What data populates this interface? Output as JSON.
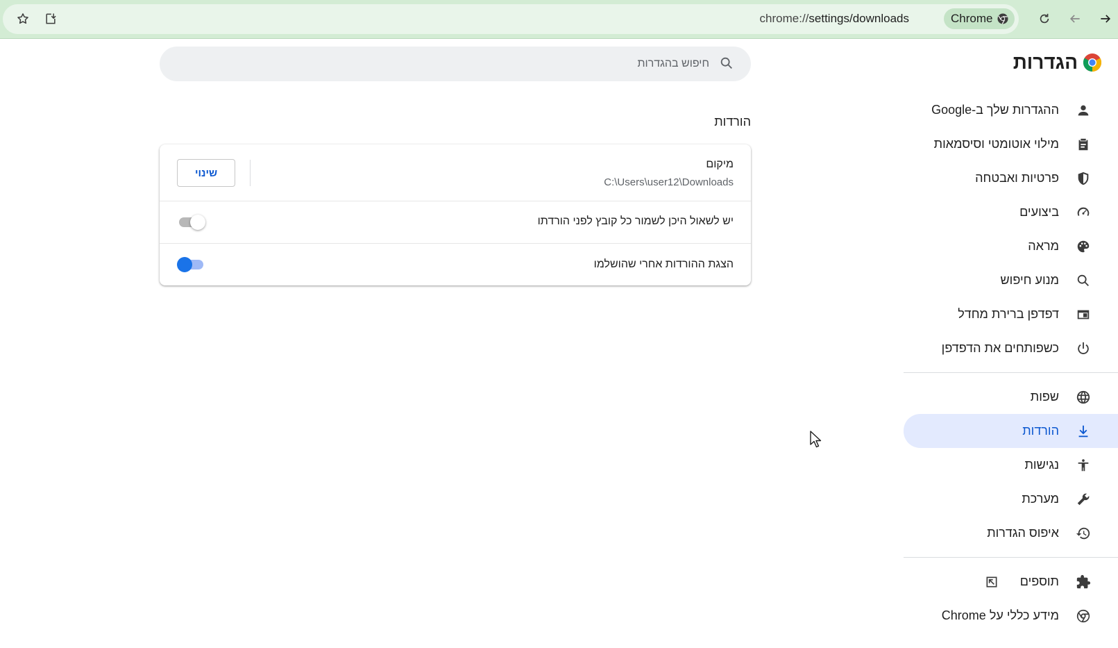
{
  "browser": {
    "url_prefix": "chrome://",
    "url_path": "settings/downloads",
    "chip_label": "Chrome",
    "toolbar_bg": "#d3ecd4"
  },
  "sidebar": {
    "title": "הגדרות",
    "items": [
      {
        "label": "ההגדרות שלך ב-Google",
        "icon": "person-icon"
      },
      {
        "label": "מילוי אוטומטי וסיסמאות",
        "icon": "clipboard-icon"
      },
      {
        "label": "פרטיות ואבטחה",
        "icon": "shield-icon"
      },
      {
        "label": "ביצועים",
        "icon": "speedometer-icon"
      },
      {
        "label": "מראה",
        "icon": "palette-icon"
      },
      {
        "label": "מנוע חיפוש",
        "icon": "search-icon"
      },
      {
        "label": "דפדפן ברירת מחדל",
        "icon": "browser-window-icon"
      },
      {
        "label": "כשפותחים את הדפדפן",
        "icon": "power-icon"
      }
    ],
    "items2": [
      {
        "label": "שפות",
        "icon": "globe-icon"
      },
      {
        "label": "הורדות",
        "icon": "download-icon",
        "active": true
      },
      {
        "label": "נגישות",
        "icon": "accessibility-icon"
      },
      {
        "label": "מערכת",
        "icon": "wrench-icon"
      },
      {
        "label": "איפוס הגדרות",
        "icon": "history-icon"
      }
    ],
    "items3": [
      {
        "label": "תוספים",
        "icon": "puzzle-icon"
      },
      {
        "label": "מידע כללי על Chrome",
        "icon": "chrome-icon"
      }
    ]
  },
  "search": {
    "placeholder": "חיפוש בהגדרות"
  },
  "downloads": {
    "section_title": "הורדות",
    "location_label": "מיקום",
    "location_path": "C:\\Users\\user12\\Downloads",
    "change_button": "שינוי",
    "ask_label": "יש לשאול היכן לשמור כל קובץ לפני הורדתו",
    "ask_enabled": false,
    "show_label": "הצגת ההורדות אחרי שהושלמו",
    "show_enabled": true
  },
  "colors": {
    "accent": "#0b57d0",
    "active_bg": "#e3eafe",
    "toggle_on": "#1a73e8"
  }
}
